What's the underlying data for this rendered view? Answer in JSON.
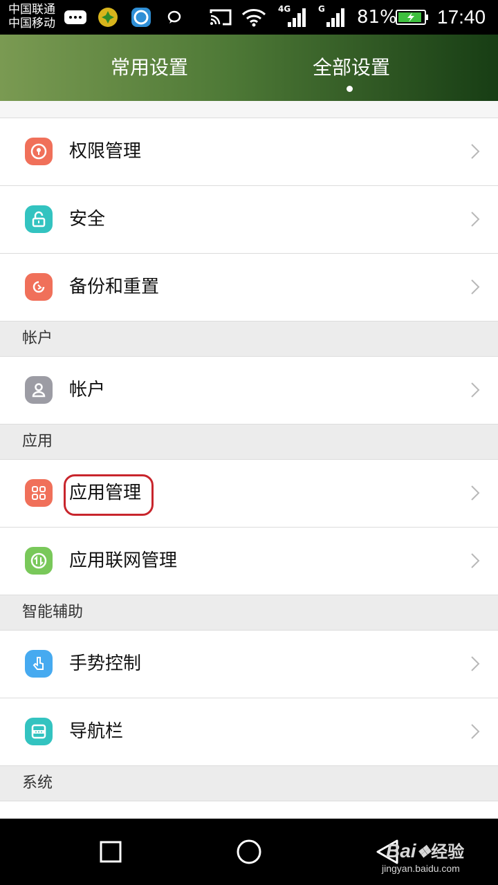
{
  "status_bar": {
    "carrier_1": "中国联通",
    "carrier_2": "中国移动",
    "network_1": "4G",
    "network_2": "G",
    "battery": "81%",
    "time": "17:40"
  },
  "tabs": {
    "common": "常用设置",
    "all": "全部设置",
    "active": "all"
  },
  "rows": {
    "permissions": "权限管理",
    "security": "安全",
    "backup": "备份和重置",
    "account": "帐户",
    "app_manage": "应用管理",
    "app_network": "应用联网管理",
    "gesture": "手势控制",
    "navbar": "导航栏"
  },
  "sections": {
    "account": "帐户",
    "apps": "应用",
    "smart": "智能辅助",
    "system": "系统"
  },
  "watermark": {
    "brand": "Bai",
    "brand_suffix": "经验",
    "url": "jingyan.baidu.com"
  },
  "colors": {
    "orange_icon": "#f0705a",
    "teal_icon": "#33c3c0",
    "gray_icon": "#9c9ca4",
    "green_icon": "#79c85a",
    "blue_icon": "#46aaf0",
    "highlight": "#c8252c"
  }
}
